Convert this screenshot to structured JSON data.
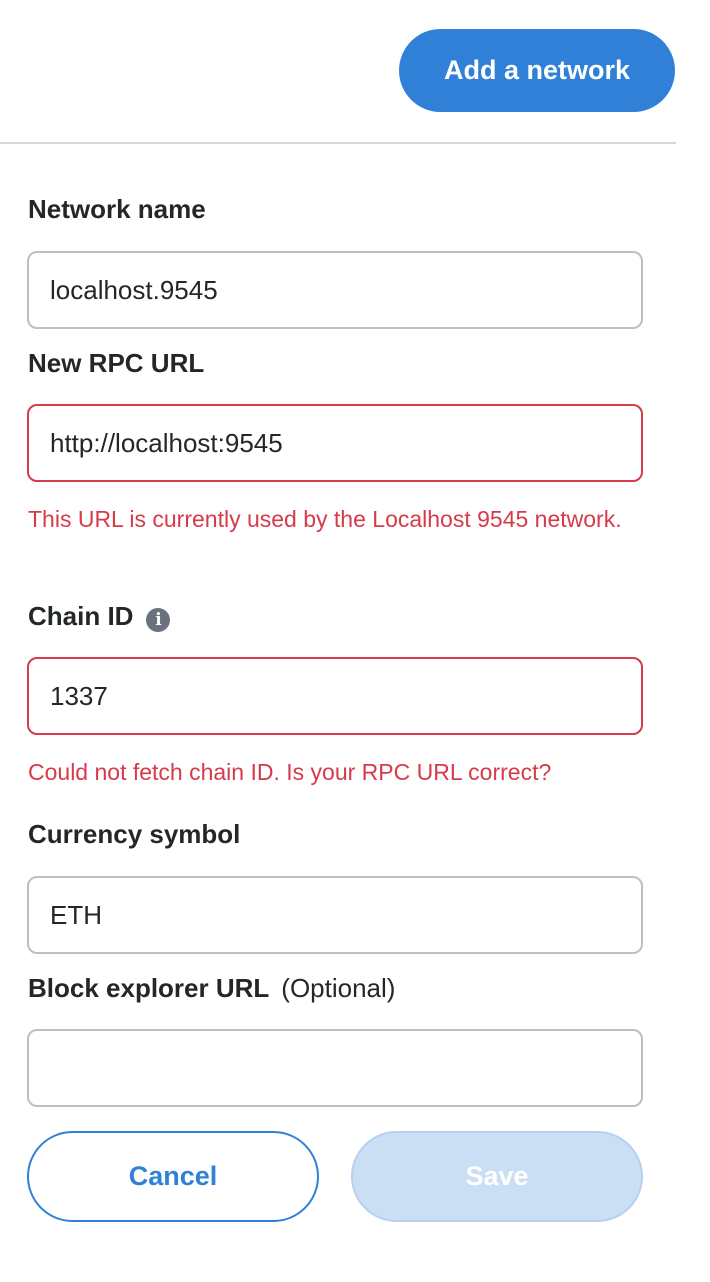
{
  "header": {
    "add_network_label": "Add a network"
  },
  "form": {
    "network_name": {
      "label": "Network name",
      "value": "localhost.9545"
    },
    "rpc_url": {
      "label": "New RPC URL",
      "value": "http://localhost:9545",
      "error": "This URL is currently used by the Localhost 9545 network."
    },
    "chain_id": {
      "label": "Chain ID",
      "info_icon": "i",
      "value": "1337",
      "error": "Could not fetch chain ID. Is your RPC URL correct?"
    },
    "currency_symbol": {
      "label": "Currency symbol",
      "value": "ETH"
    },
    "block_explorer": {
      "label": "Block explorer URL",
      "optional": "(Optional)",
      "value": ""
    }
  },
  "actions": {
    "cancel_label": "Cancel",
    "save_label": "Save"
  },
  "colors": {
    "primary": "#2f80d6",
    "error": "#d73a49",
    "save_disabled_bg": "#cadff3"
  }
}
